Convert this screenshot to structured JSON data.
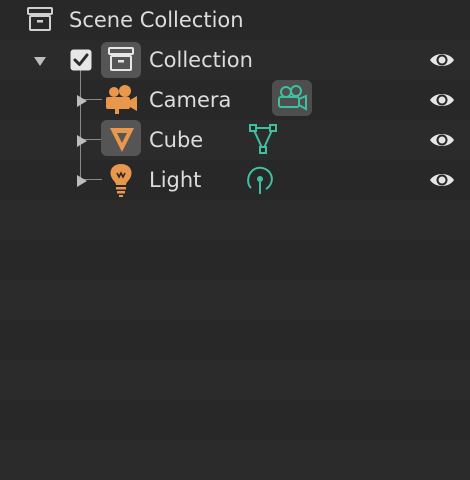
{
  "outliner": {
    "scene_collection": {
      "label": "Scene Collection",
      "icon": "scene-collection-icon"
    },
    "collection": {
      "label": "Collection",
      "expanded": true,
      "checked": true,
      "icon": "collection-icon",
      "visible": true
    },
    "objects": [
      {
        "label": "Camera",
        "icon": "camera-icon",
        "data_icon": "camera-data-icon",
        "visible": true
      },
      {
        "label": "Cube",
        "icon": "mesh-cube-icon",
        "data_icon": "mesh-data-icon",
        "visible": true
      },
      {
        "label": "Light",
        "icon": "light-icon",
        "data_icon": "light-data-icon",
        "visible": true
      }
    ]
  },
  "colors": {
    "background": "#282828",
    "row_alt": "#2b2b2b",
    "text": "#dcdcdc",
    "object_orange": "#e8974b",
    "data_green": "#3ec0a0",
    "icon_gray": "#d0d0d0"
  }
}
